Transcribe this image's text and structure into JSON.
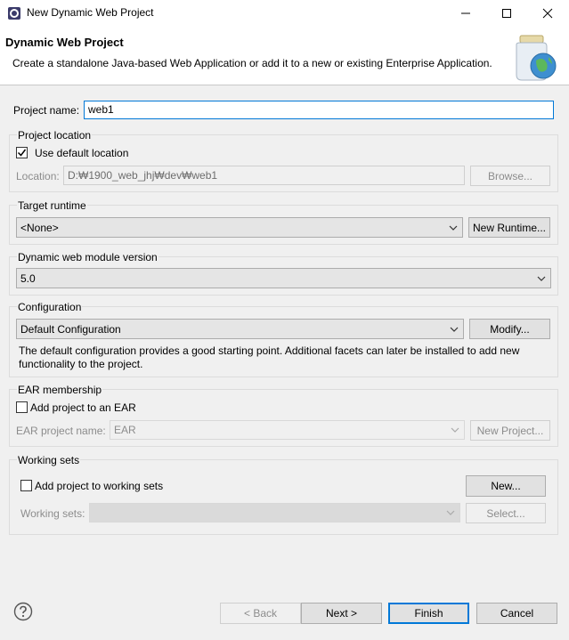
{
  "window": {
    "title": "New Dynamic Web Project"
  },
  "header": {
    "title": "Dynamic Web Project",
    "description": "Create a standalone Java-based Web Application or add it to a new or existing Enterprise Application."
  },
  "project_name": {
    "label": "Project name:",
    "value": "web1"
  },
  "project_location": {
    "legend": "Project location",
    "use_default_label": "Use default location",
    "use_default_checked": true,
    "location_label": "Location:",
    "location_value": "D:₩1900_web_jhj₩dev₩web1",
    "browse_label": "Browse..."
  },
  "target_runtime": {
    "legend": "Target runtime",
    "selected": "<None>",
    "new_runtime_label": "New Runtime..."
  },
  "module_version": {
    "legend": "Dynamic web module version",
    "selected": "5.0"
  },
  "configuration": {
    "legend": "Configuration",
    "selected": "Default Configuration",
    "modify_label": "Modify...",
    "description": "The default configuration provides a good starting point. Additional facets can later be installed to add new functionality to the project."
  },
  "ear": {
    "legend": "EAR membership",
    "add_label": "Add project to an EAR",
    "add_checked": false,
    "project_name_label": "EAR project name:",
    "project_name_value": "EAR",
    "new_project_label": "New Project..."
  },
  "working_sets": {
    "legend": "Working sets",
    "add_label": "Add project to working sets",
    "add_checked": false,
    "new_label": "New...",
    "sets_label": "Working sets:",
    "sets_value": "",
    "select_label": "Select..."
  },
  "footer": {
    "help_icon": "help-icon",
    "back_label": "< Back",
    "next_label": "Next >",
    "finish_label": "Finish",
    "cancel_label": "Cancel"
  },
  "colors": {
    "focus": "#0078d7",
    "window_bg": "#f0f0f0"
  }
}
